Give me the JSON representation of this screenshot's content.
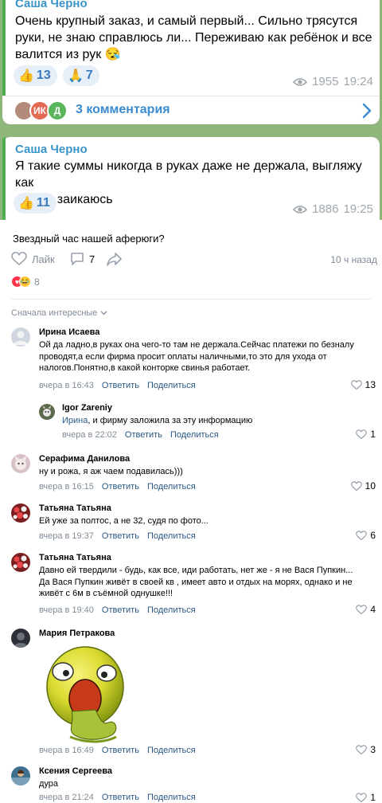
{
  "channel": {
    "message1": {
      "sender": "Саша Черно",
      "text_lines": [
        "Очень крупный заказ, и самый первый... Сильно трясутся",
        "руки, не знаю справлюсь ли... Переживаю как ребёнок и все",
        "валится из рук 😪"
      ],
      "reactions": [
        {
          "emoji": "👍",
          "count": "13"
        },
        {
          "emoji": "🙏",
          "count": "7"
        }
      ],
      "views": "1955",
      "time": "19:24"
    },
    "comments_bar": {
      "avatars": [
        "",
        "ИК",
        "Д"
      ],
      "label": "3 комментария"
    },
    "message2": {
      "sender": "Саша Черно",
      "text_lines": [
        "Я такие суммы никогда в руках даже не держала, выгляжу как",
        "дура и заикаюсь"
      ],
      "reactions": [
        {
          "emoji": "👍",
          "count": "11"
        }
      ],
      "views": "1886",
      "time": "19:25"
    }
  },
  "post": {
    "text": "Звездный час нашей аферюги?",
    "like_label": "Лайк",
    "comments_count": "7",
    "time_ago": "10 ч назад",
    "reactions_count": "8",
    "sort_label": "Сначала интересные"
  },
  "comments": [
    {
      "name": "Ирина Исаева",
      "lines": [
        "Ой да ладно,в руках она чего-то там не держала.Сейчас платежи по безналу",
        "проводят,а если фирма просит оплаты наличными,то это для ухода от",
        "налогов.Понятно,в какой конторке свинья работает."
      ],
      "date": "вчера в 16:43",
      "reply": "Ответить",
      "share": "Поделиться",
      "likes": "13"
    },
    {
      "name": "Igor Zareniy",
      "mention": "Ирина",
      "lines": [
        ", и фирму заложила за эту информацию"
      ],
      "date": "вчера в 22:02",
      "reply": "Ответить",
      "share": "Поделиться",
      "likes": "1"
    },
    {
      "name": "Серафима Данилова",
      "lines": [
        "ну и рожа, я аж чаем подавилась)))"
      ],
      "date": "вчера в 16:15",
      "reply": "Ответить",
      "share": "Поделиться",
      "likes": "10"
    },
    {
      "name": "Татьяна Татьяна",
      "lines": [
        "Ей уже за полтос, а не 32, судя по фото..."
      ],
      "date": "вчера в 19:37",
      "reply": "Ответить",
      "share": "Поделиться",
      "likes": "6"
    },
    {
      "name": "Татьяна Татьяна",
      "lines": [
        "Давно ей твердили - будь, как все, иди работать, нет же - я не Вася Пупкин...",
        "Да Вася Пупкин живёт в своей кв , имеет авто и отдых на морях, однако и не",
        "живёт с 6м в съёмной однушке!!!"
      ],
      "date": "вчера в 19:40",
      "reply": "Ответить",
      "share": "Поделиться",
      "likes": "4"
    },
    {
      "name": "Мария Петракова",
      "lines": [],
      "date": "вчера в 16:49",
      "reply": "Ответить",
      "share": "Поделиться",
      "likes": "3"
    },
    {
      "name": "Ксения Сергеева",
      "lines": [
        "дура"
      ],
      "date": "вчера в 21:24",
      "reply": "Ответить",
      "share": "Поделиться",
      "likes": "1"
    }
  ],
  "colors": {
    "telegram_bg": "#8fb67a",
    "sender": "#3a94c8",
    "reaction_bg": "#e6eef8",
    "vk_link": "#2a5885",
    "muted": "#818c99"
  },
  "icons": [
    "eye-icon",
    "chevron-right-icon",
    "heart-icon",
    "comment-icon",
    "share-icon",
    "chevron-down-icon"
  ]
}
